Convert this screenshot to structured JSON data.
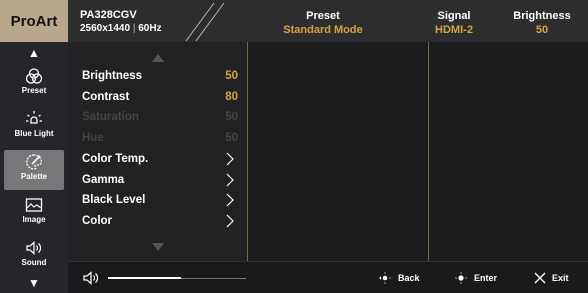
{
  "header": {
    "brand": "ProArt",
    "model": "PA328CGV",
    "resolution": "2560x1440",
    "refresh": "60Hz",
    "preset_label": "Preset",
    "preset_value": "Standard Mode",
    "signal_label": "Signal",
    "signal_value": "HDMI-2",
    "brightness_label": "Brightness",
    "brightness_value": "50"
  },
  "sidebar": {
    "items": [
      {
        "label": "Preset",
        "icon": "preset-icon"
      },
      {
        "label": "Blue Light",
        "icon": "blue-light-icon"
      },
      {
        "label": "Palette",
        "icon": "palette-icon"
      },
      {
        "label": "Image",
        "icon": "image-icon"
      },
      {
        "label": "Sound",
        "icon": "sound-icon"
      }
    ]
  },
  "menu": {
    "items": [
      {
        "label": "Brightness",
        "value": "50"
      },
      {
        "label": "Contrast",
        "value": "80"
      },
      {
        "label": "Saturation",
        "value": "50"
      },
      {
        "label": "Hue",
        "value": "50"
      },
      {
        "label": "Color Temp."
      },
      {
        "label": "Gamma"
      },
      {
        "label": "Black Level"
      },
      {
        "label": "Color"
      }
    ]
  },
  "footer": {
    "volume_fraction": 0.53,
    "back_label": "Back",
    "enter_label": "Enter",
    "exit_label": "Exit"
  },
  "colors": {
    "accent": "#d6a43d",
    "brand_bg": "#b8a78b",
    "active_item": "#777779"
  }
}
